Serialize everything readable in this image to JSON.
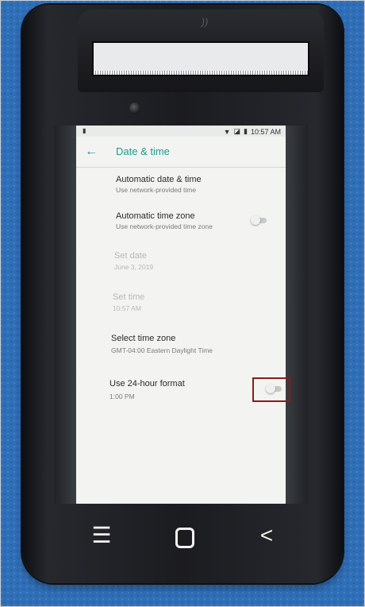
{
  "status_bar": {
    "time": "10:57 AM",
    "left_icon": "sd-card-icon",
    "right_icons": [
      "wifi-icon",
      "signal-icon",
      "battery-icon"
    ]
  },
  "header": {
    "title": "Date & time",
    "back_icon": "←"
  },
  "settings": [
    {
      "title": "Automatic date & time",
      "summary": "Use network-provided time",
      "enabled": true
    },
    {
      "title": "Automatic time zone",
      "summary": "Use network-provided time zone",
      "enabled": true,
      "toggle": "off"
    },
    {
      "title": "Set date",
      "summary": "June 3, 2019",
      "enabled": false
    },
    {
      "title": "Set time",
      "summary": "10:57 AM",
      "enabled": false
    },
    {
      "title": "Select time zone",
      "summary": "GMT-04:00 Eastern Daylight Time",
      "enabled": true
    },
    {
      "title": "Use 24-hour format",
      "summary": "1:00 PM",
      "enabled": true,
      "toggle": "off"
    }
  ],
  "nav": {
    "menu": "☰",
    "back": "<"
  },
  "colors": {
    "accent": "#1d9a8c",
    "highlight": "#8a1b1b"
  }
}
